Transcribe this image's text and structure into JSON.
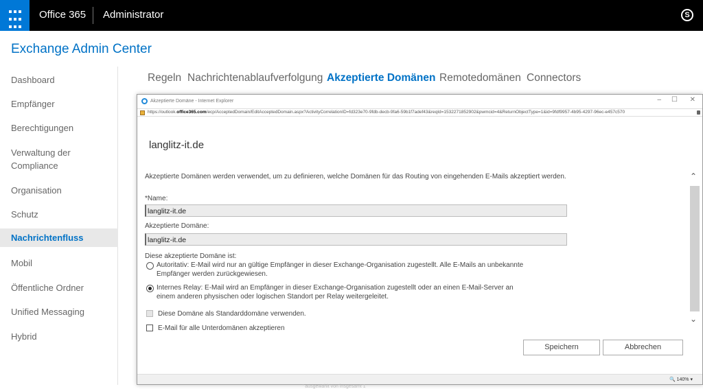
{
  "topbar": {
    "app_name": "Office 365",
    "admin_name": "Administrator",
    "skype_label": "S"
  },
  "eac_title": "Exchange Admin Center",
  "nav": {
    "items": [
      {
        "label": "Dashboard"
      },
      {
        "label": "Empfänger"
      },
      {
        "label": "Berechtigungen"
      },
      {
        "label": "Verwaltung der Compliance"
      },
      {
        "label": "Organisation"
      },
      {
        "label": "Schutz"
      },
      {
        "label": "Nachrichtenfluss"
      },
      {
        "label": "Mobil"
      },
      {
        "label": "Öffentliche Ordner"
      },
      {
        "label": "Unified Messaging"
      },
      {
        "label": "Hybrid"
      }
    ],
    "active": "Nachrichtenfluss"
  },
  "tabs": [
    {
      "label": "Regeln"
    },
    {
      "label": "Nachrichtenablaufverfolgung"
    },
    {
      "label": "Akzeptierte Domänen"
    },
    {
      "label": "Remotedomänen"
    },
    {
      "label": "Connectors"
    }
  ],
  "ie": {
    "title": "Akzeptierte Domäne - Internet Explorer",
    "url_prefix": "https://outlook.",
    "url_host": "office365.com",
    "url_rest": "/ecp/AcceptedDomain/EditAcceptedDomain.aspx?ActivityCorrelationID=fd323e70-9fdb-decb-9fa6-59b1f7adef43&reqId=1532271852902&pwmcid=4&ReturnObjectType=1&id=9fdf9957-4b95-4297-96ec-e457c570",
    "zoom": "140%",
    "behind_text": "' ausgewählt von insgesamt 1"
  },
  "dialog": {
    "heading": "langlitz-it.de",
    "description": "Akzeptierte Domänen werden verwendet, um zu definieren, welche Domänen für das Routing von eingehenden E-Mails akzeptiert werden.",
    "name_label": "*Name:",
    "name_value": "langlitz-it.de",
    "domain_label": "Akzeptierte Domäne:",
    "domain_value": "langlitz-it.de",
    "type_label": "Diese akzeptierte Domäne ist:",
    "radio_authoritative": "Autoritativ: E-Mail wird nur an gültige Empfänger in dieser Exchange-Organisation zugestellt. Alle E-Mails an unbekannte Empfänger werden zurückgewiesen.",
    "radio_internal_relay": "Internes Relay: E-Mail wird an Empfänger in dieser Exchange-Organisation zugestellt oder an einen E-Mail-Server an einem anderen physischen oder logischen Standort per Relay weitergeleitet.",
    "selected_type": "internal_relay",
    "checkbox_default": "Diese Domäne als Standarddomäne verwenden.",
    "checkbox_subdomains": "E-Mail für alle Unterdomänen akzeptieren",
    "save_label": "Speichern",
    "cancel_label": "Abbrechen"
  },
  "colors": {
    "accent": "#0072c6",
    "waffle": "#0078d7",
    "topbar": "#000000"
  }
}
